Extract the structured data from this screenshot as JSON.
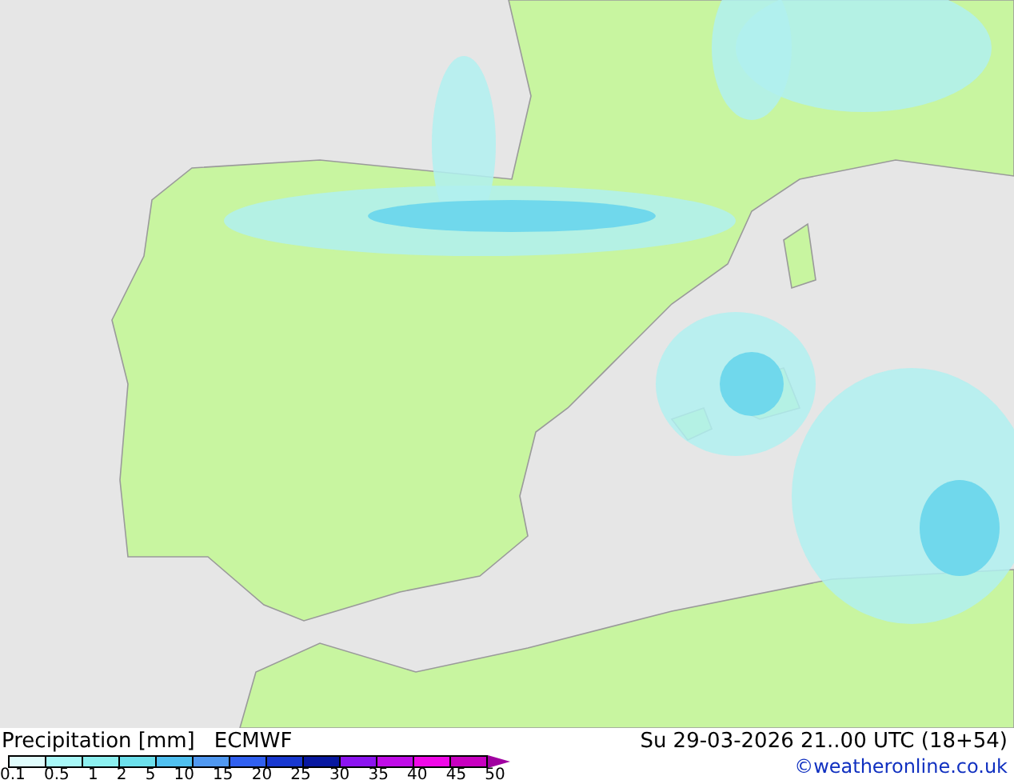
{
  "map": {
    "kind": "precipitation"
  },
  "legend": {
    "title": "Precipitation [mm]",
    "model": "ECMWF",
    "classes": [
      {
        "color": "#e0fcfc"
      },
      {
        "color": "#a8f8f8"
      },
      {
        "color": "#8cf0f0"
      },
      {
        "color": "#6ce0ec"
      },
      {
        "color": "#50c0f0"
      },
      {
        "color": "#5098f0"
      },
      {
        "color": "#3060f0"
      },
      {
        "color": "#1838d0"
      },
      {
        "color": "#0818a0"
      },
      {
        "color": "#8c14f0"
      },
      {
        "color": "#c00ce8"
      },
      {
        "color": "#f008e8"
      },
      {
        "color": "#c800c0"
      }
    ],
    "ticks": [
      "0.1",
      "0.5",
      "1",
      "2",
      "5",
      "10",
      "15",
      "20",
      "25",
      "30",
      "35",
      "40",
      "45",
      "50"
    ]
  },
  "valid_time": "Su 29-03-2026 21..00 UTC (18+54)",
  "copyright": "©weatheronline.co.uk"
}
